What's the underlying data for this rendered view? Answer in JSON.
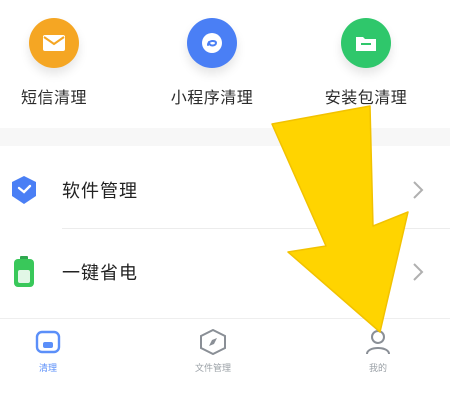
{
  "tools": [
    {
      "label": "短信清理",
      "icon": "message-icon",
      "color": "#f5a623"
    },
    {
      "label": "小程序清理",
      "icon": "mini-program-icon",
      "color": "#4a7ff5"
    },
    {
      "label": "安装包清理",
      "icon": "folder-icon",
      "color": "#2fc76b"
    }
  ],
  "menu": [
    {
      "label": "软件管理",
      "icon": "app-shield-icon",
      "color": "#4a7ff5"
    },
    {
      "label": "一键省电",
      "icon": "battery-icon",
      "color": "#39c85a"
    }
  ],
  "tabs": [
    {
      "label": "清理",
      "icon": "home-icon",
      "active": true
    },
    {
      "label": "文件管理",
      "icon": "compass-icon",
      "active": false
    },
    {
      "label": "我的",
      "icon": "person-icon",
      "active": false
    }
  ],
  "colors": {
    "accent": "#5b8ff9",
    "arrow": "#ffd400"
  }
}
